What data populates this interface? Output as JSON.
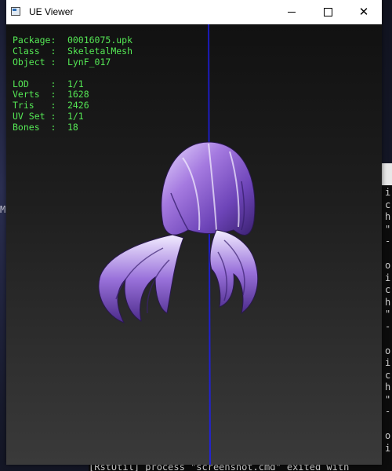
{
  "window": {
    "title": "UE Viewer",
    "controls": {
      "minimize": "minimize-icon",
      "maximize": "maximize-icon",
      "close": "close-icon"
    }
  },
  "info": {
    "package_label": "Package:",
    "package_value": "00016075.upk",
    "class_label": "Class  :",
    "class_value": "SkeletalMesh",
    "object_label": "Object :",
    "object_value": "LynF_017",
    "lod_label": "LOD    :",
    "lod_value": "1/1",
    "verts_label": "Verts  :",
    "verts_value": "1628",
    "tris_label": "Tris   :",
    "tris_value": "2426",
    "uvset_label": "UV Set :",
    "uvset_value": "1/1",
    "bones_label": "Bones  :",
    "bones_value": "18"
  },
  "terminal": {
    "lines": [
      "i",
      "c",
      "h",
      "\"",
      "-",
      "",
      "o",
      "i",
      "c",
      "h",
      "\"",
      "-",
      "",
      "o",
      "i",
      "c",
      "h",
      "\"",
      "-",
      "",
      "o",
      "i"
    ],
    "bottom_text": "[RstUtil] process \"screenshot.cmd\" exited with"
  },
  "desktop": {
    "glyph": "M"
  },
  "colors": {
    "info_text": "#55e855",
    "axis": "#2323d8",
    "hair_main": "#9b6fd6"
  }
}
